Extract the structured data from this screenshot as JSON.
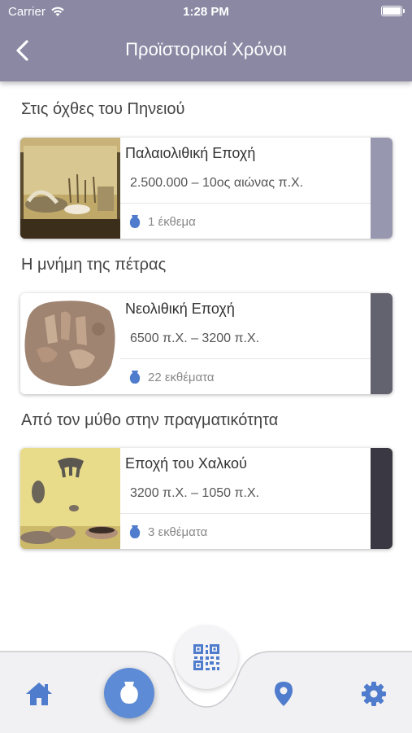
{
  "status_bar": {
    "carrier": "Carrier",
    "time": "1:28 PM"
  },
  "header": {
    "title": "Προϊστορικοί Χρόνοι"
  },
  "sections": [
    {
      "title": "Στις όχθες του Πηνειού",
      "card": {
        "name": "Παλαιολιθική Εποχή",
        "period": "2.500.000 – 10ος αιώνας π.Χ.",
        "count": "1 έκθεμα",
        "accent": "#9897b0"
      }
    },
    {
      "title": "Η μνήμη της πέτρας",
      "card": {
        "name": "Νεολιθική Εποχή",
        "period": "6500 π.Χ. – 3200 π.Χ.",
        "count": "22 εκθέματα",
        "accent": "#63626f"
      }
    },
    {
      "title": "Από τον μύθο στην πραγματικότητα",
      "card": {
        "name": "Εποχή του Χαλκού",
        "period": "3200 π.Χ. – 1050 π.Χ.",
        "count": "3 εκθέματα",
        "accent": "#3a3943"
      }
    }
  ],
  "tabbar": {
    "tabs": [
      "home-icon",
      "vase-icon",
      "qr-code-icon",
      "location-pin-icon",
      "gear-icon"
    ]
  },
  "colors": {
    "header": "#8a88a3",
    "accent_blue": "#4f7ccc",
    "center_button": "#5e8bd6"
  }
}
